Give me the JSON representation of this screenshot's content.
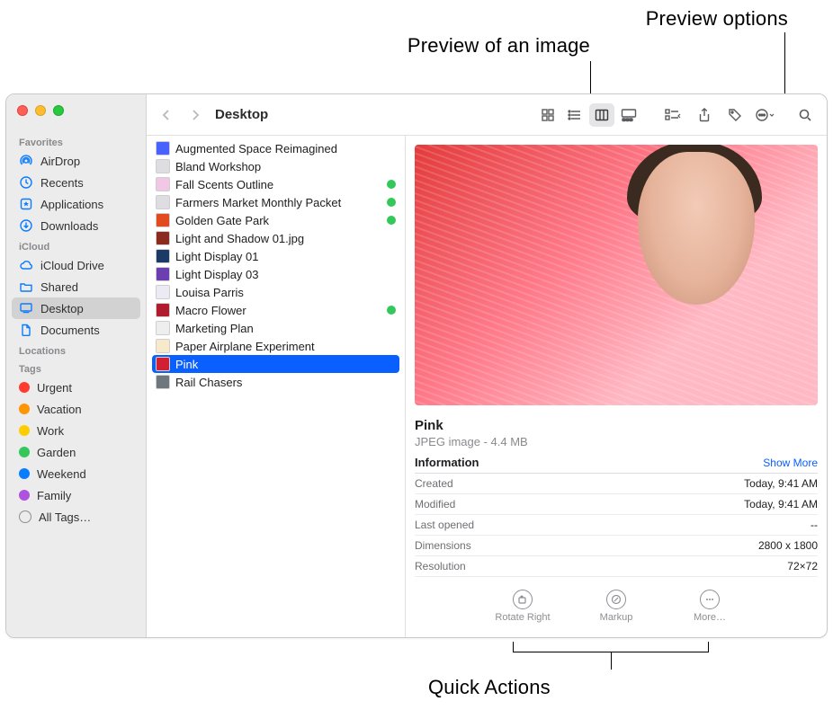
{
  "callouts": {
    "preview_image": "Preview of an image",
    "preview_options": "Preview options",
    "quick_actions": "Quick Actions"
  },
  "toolbar": {
    "title": "Desktop"
  },
  "sidebar": {
    "headings": {
      "favorites": "Favorites",
      "icloud": "iCloud",
      "locations": "Locations",
      "tags": "Tags"
    },
    "favorites": [
      {
        "label": "AirDrop"
      },
      {
        "label": "Recents"
      },
      {
        "label": "Applications"
      },
      {
        "label": "Downloads"
      }
    ],
    "icloud": [
      {
        "label": "iCloud Drive"
      },
      {
        "label": "Shared"
      },
      {
        "label": "Desktop",
        "selected": true
      },
      {
        "label": "Documents"
      }
    ],
    "tags": [
      {
        "label": "Urgent",
        "color": "#ff3b30"
      },
      {
        "label": "Vacation",
        "color": "#ff9500"
      },
      {
        "label": "Work",
        "color": "#ffcc00"
      },
      {
        "label": "Garden",
        "color": "#34c759"
      },
      {
        "label": "Weekend",
        "color": "#0a7cff"
      },
      {
        "label": "Family",
        "color": "#af52de"
      },
      {
        "label": "All Tags…"
      }
    ]
  },
  "files": [
    {
      "name": "Augmented Space Reimagined",
      "icon_bg": "#4762ff"
    },
    {
      "name": "Bland Workshop",
      "icon_bg": "#dedee2"
    },
    {
      "name": "Fall Scents Outline",
      "icon_bg": "#f2c7e6",
      "green": true
    },
    {
      "name": "Farmers Market Monthly Packet",
      "icon_bg": "#dedee2",
      "green": true
    },
    {
      "name": "Golden Gate Park",
      "icon_bg": "#e24b1f",
      "green": true
    },
    {
      "name": "Light and Shadow 01.jpg",
      "icon_bg": "#8b2b1f"
    },
    {
      "name": "Light Display 01",
      "icon_bg": "#1b3a66"
    },
    {
      "name": "Light Display 03",
      "icon_bg": "#6b3fb0"
    },
    {
      "name": "Louisa Parris",
      "icon_bg": "#eceaf2"
    },
    {
      "name": "Macro Flower",
      "icon_bg": "#b01c2e",
      "green": true
    },
    {
      "name": "Marketing Plan",
      "icon_bg": "#eeeeee"
    },
    {
      "name": "Paper Airplane Experiment",
      "icon_bg": "#f7eacb"
    },
    {
      "name": "Pink",
      "icon_bg": "#d1202f",
      "selected": true
    },
    {
      "name": "Rail Chasers",
      "icon_bg": "#6e767e"
    }
  ],
  "preview": {
    "title": "Pink",
    "subtitle": "JPEG image - 4.4 MB",
    "info_label": "Information",
    "show_more": "Show More",
    "rows": [
      {
        "label": "Created",
        "value": "Today, 9:41 AM"
      },
      {
        "label": "Modified",
        "value": "Today, 9:41 AM"
      },
      {
        "label": "Last opened",
        "value": "--"
      },
      {
        "label": "Dimensions",
        "value": "2800 x 1800"
      },
      {
        "label": "Resolution",
        "value": "72×72"
      }
    ],
    "quick_actions": [
      {
        "label": "Rotate Right"
      },
      {
        "label": "Markup"
      },
      {
        "label": "More…"
      }
    ]
  }
}
